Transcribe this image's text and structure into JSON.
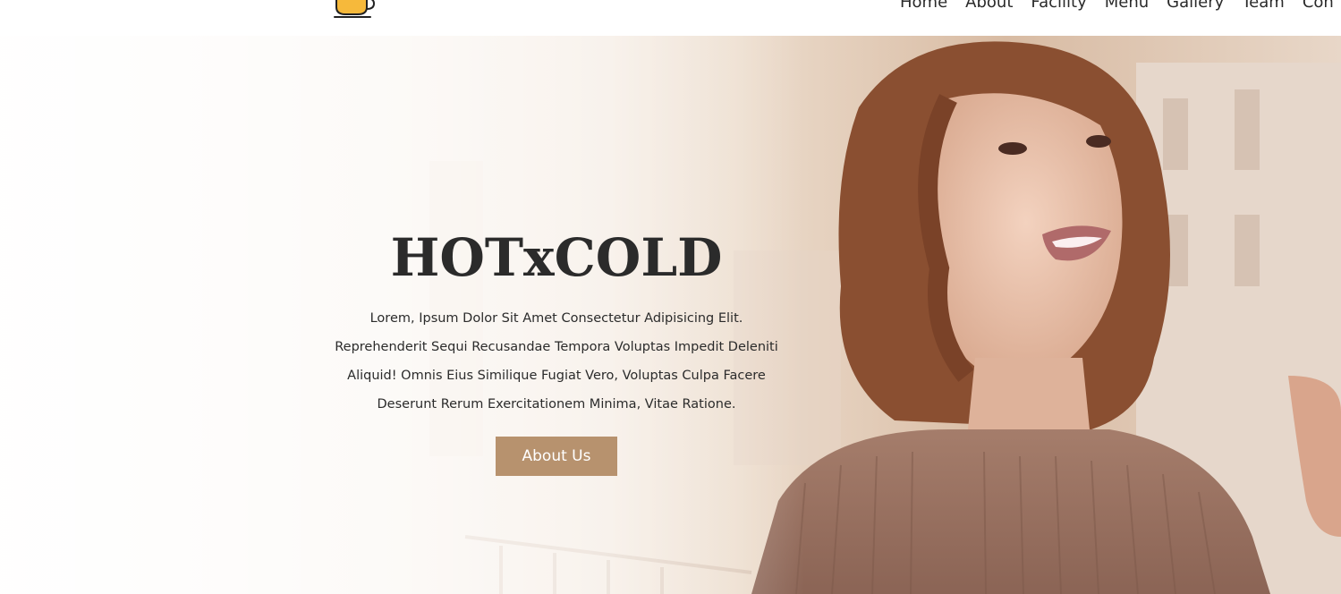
{
  "header": {
    "logo_icon": "coffee-cup-icon",
    "nav": [
      {
        "label": "Home"
      },
      {
        "label": "About"
      },
      {
        "label": "Facility"
      },
      {
        "label": "Menu"
      },
      {
        "label": "Gallery"
      },
      {
        "label": "Team"
      },
      {
        "label": "Con"
      }
    ]
  },
  "hero": {
    "title": "HOTxCOLD",
    "description": "Lorem, Ipsum Dolor Sit Amet Consectetur Adipisicing Elit. Reprehenderit Sequi Recusandae Tempora Voluptas Impedit Deleniti Aliquid! Omnis Eius Similique Fugiat Vero, Voluptas Culpa Facere Deserunt Rerum Exercitationem Minima, Vitae Ratione.",
    "button_label": "About Us",
    "background_image": "woman-on-balcony-photo"
  },
  "colors": {
    "accent": "#b7926e",
    "text": "#2b2b2b",
    "logo_yellow": "#f6b93b"
  }
}
